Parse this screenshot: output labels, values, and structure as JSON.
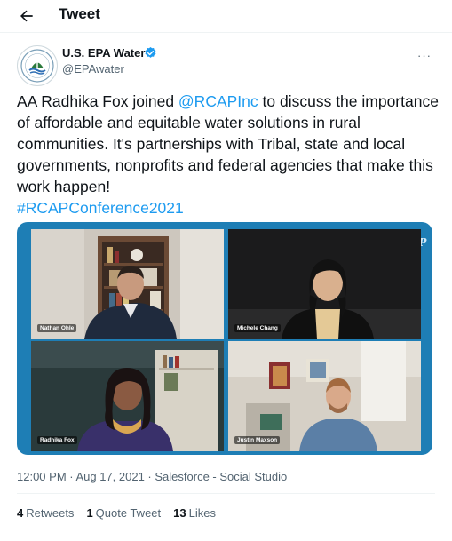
{
  "header": {
    "title": "Tweet"
  },
  "author": {
    "name": "U.S. EPA Water",
    "handle": "@EPAwater"
  },
  "tweet": {
    "text_before": "AA Radhika Fox joined ",
    "mention": "@RCAPInc",
    "text_after": " to discuss the importance of affordable and equitable water solutions in rural communities. It's partnerships with Tribal, state and local governments, nonprofits and federal agencies that make this work happen!",
    "hashtag": "#RCAPConference2021"
  },
  "media": {
    "logo_text": "RCAP",
    "participants": [
      "Nathan Ohle",
      "Michele Chang",
      "Radhika Fox",
      "Justin Maxson"
    ]
  },
  "meta": {
    "timestamp": "12:00 PM · Aug 17, 2021 · Salesforce - Social Studio"
  },
  "stats": {
    "retweets_count": "4",
    "retweets_label": "Retweets",
    "quotes_count": "1",
    "quotes_label": "Quote Tweet",
    "likes_count": "13",
    "likes_label": "Likes"
  },
  "colors": {
    "link": "#1d9bf0",
    "verified": "#1d9bf0",
    "media_bg": "#1e7eb5"
  },
  "icons": [
    "back-arrow-icon",
    "verified-badge-icon",
    "more-options-icon",
    "epa-logo-icon"
  ]
}
